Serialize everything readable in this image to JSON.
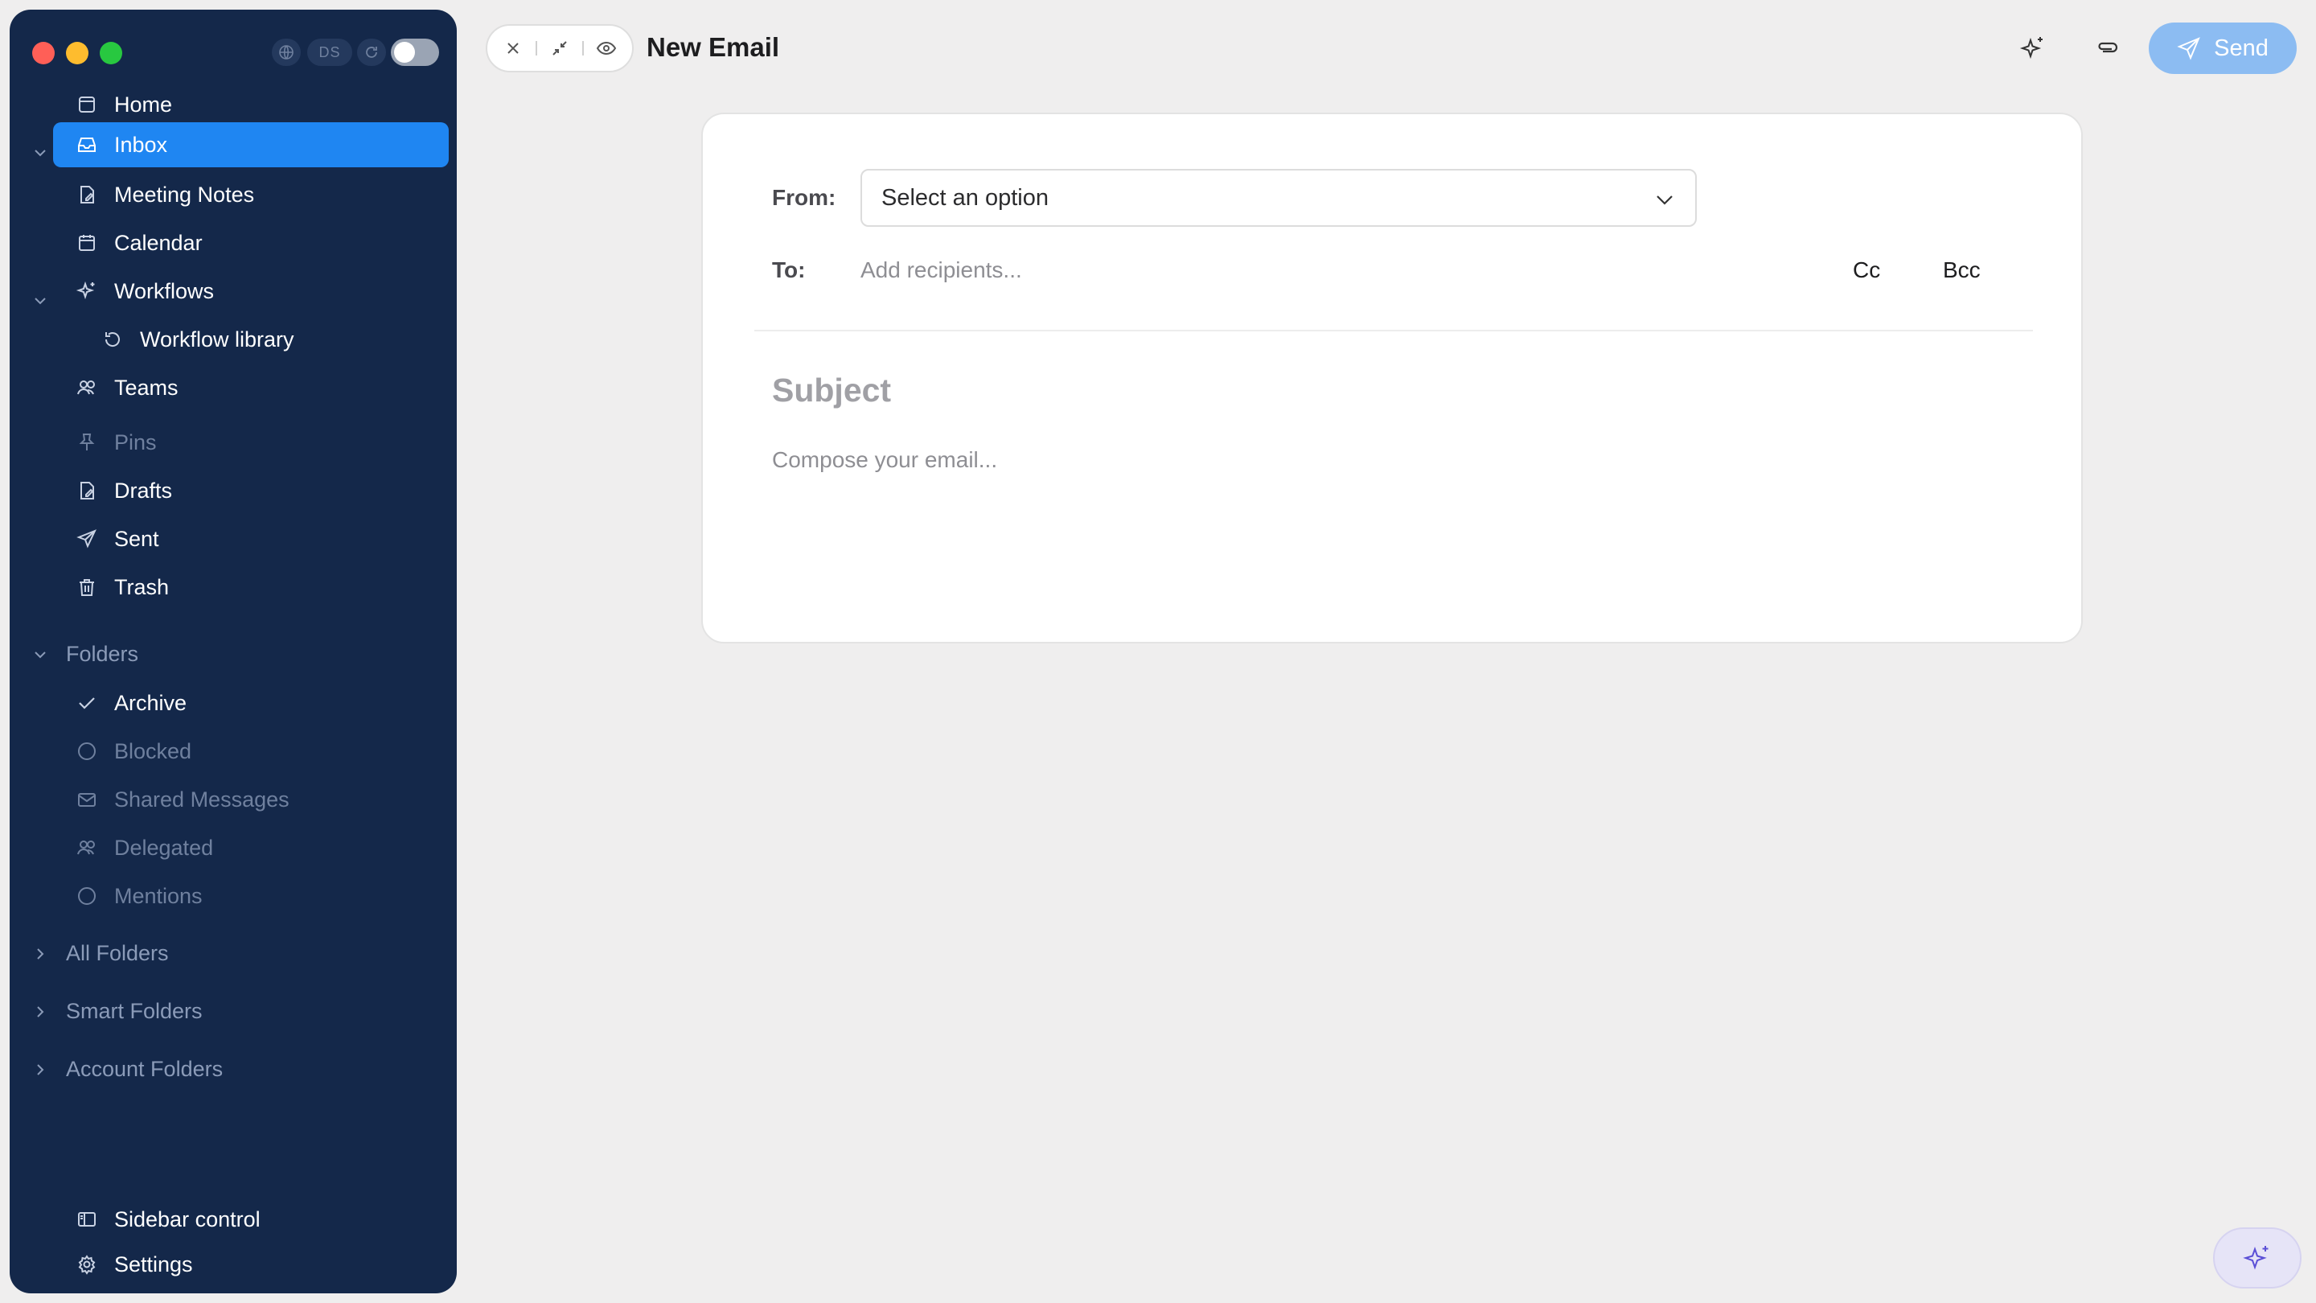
{
  "window_controls": {
    "ds_label": "DS"
  },
  "sidebar": {
    "items": [
      {
        "label": "Home",
        "icon": "home-icon"
      },
      {
        "label": "Inbox",
        "icon": "inbox-icon",
        "active": true
      },
      {
        "label": "Meeting Notes",
        "icon": "note-icon"
      },
      {
        "label": "Calendar",
        "icon": "calendar-icon"
      },
      {
        "label": "Workflows",
        "icon": "sparkles-icon"
      },
      {
        "label": "Workflow library",
        "icon": "history-icon"
      },
      {
        "label": "Teams",
        "icon": "users-icon"
      },
      {
        "label": "Pins",
        "icon": "pin-icon"
      },
      {
        "label": "Drafts",
        "icon": "draft-icon"
      },
      {
        "label": "Sent",
        "icon": "send-icon"
      },
      {
        "label": "Trash",
        "icon": "trash-icon"
      }
    ],
    "folders_label": "Folders",
    "folders": [
      {
        "label": "Archive",
        "icon": "check-icon"
      },
      {
        "label": "Blocked",
        "icon": "circle-icon"
      },
      {
        "label": "Shared Messages",
        "icon": "mail-icon"
      },
      {
        "label": "Delegated",
        "icon": "users-icon"
      },
      {
        "label": "Mentions",
        "icon": "circle-icon"
      }
    ],
    "sections": [
      "All Folders",
      "Smart Folders",
      "Account Folders"
    ],
    "footer": {
      "sidebar_control": "Sidebar control",
      "settings": "Settings"
    }
  },
  "header": {
    "title": "New Email",
    "send_label": "Send"
  },
  "compose": {
    "from_label": "From:",
    "from_placeholder": "Select an option",
    "to_label": "To:",
    "to_placeholder": "Add recipients...",
    "cc_label": "Cc",
    "bcc_label": "Bcc",
    "subject_placeholder": "Subject",
    "body_placeholder": "Compose your email..."
  },
  "colors": {
    "sidebar_bg": "#14284a",
    "active_item": "#1f86f2",
    "send_button": "#8cbcf2",
    "background": "#efeeee"
  }
}
